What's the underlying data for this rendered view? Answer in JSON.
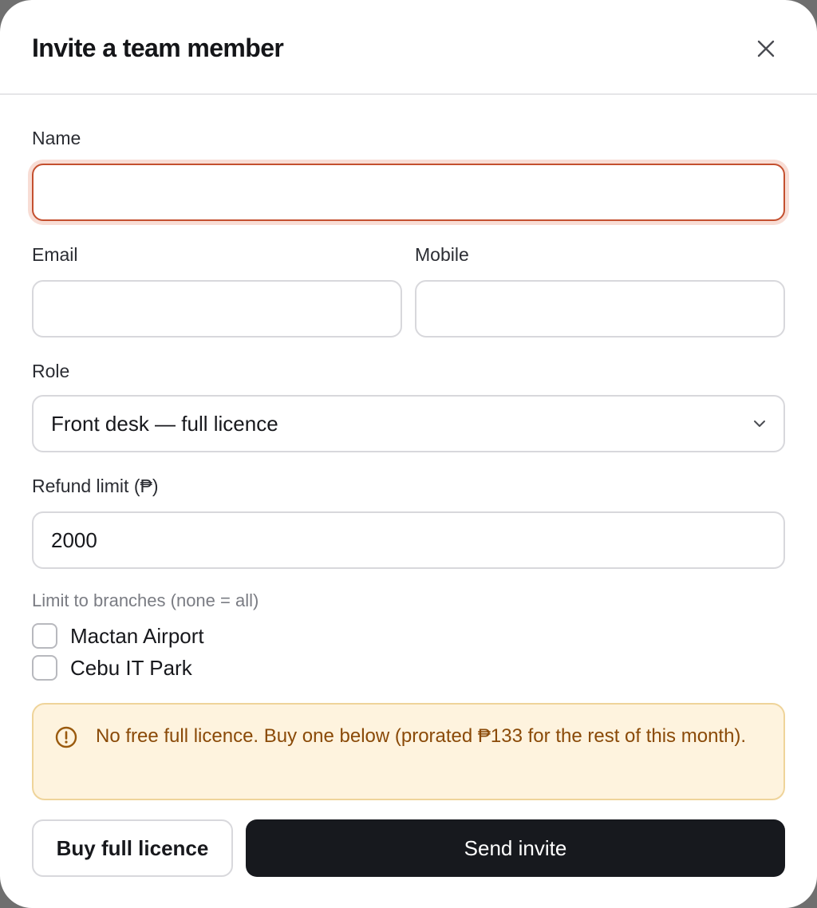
{
  "modal": {
    "title": "Invite a team member",
    "close_icon": "close-icon"
  },
  "form": {
    "name": {
      "label": "Name",
      "value": ""
    },
    "email": {
      "label": "Email",
      "value": ""
    },
    "mobile": {
      "label": "Mobile",
      "value": ""
    },
    "role": {
      "label": "Role",
      "selected": "Front desk — full licence",
      "icon": "chevron-down-icon"
    },
    "refund_limit": {
      "label": "Refund limit (₱)",
      "value": "2000"
    },
    "branches": {
      "hint": "Limit to branches (none = all)",
      "options": [
        {
          "label": "Mactan Airport",
          "checked": false
        },
        {
          "label": "Cebu IT Park",
          "checked": false
        }
      ]
    }
  },
  "warning": {
    "icon": "alert-circle-icon",
    "message": "No free full licence. Buy one below (prorated ₱133 for the rest of this month)."
  },
  "actions": {
    "buy_label": "Buy full licence",
    "send_label": "Send invite"
  },
  "colors": {
    "focus_border": "#c4502f",
    "warning_bg": "#fef3de",
    "warning_text": "#8a4a08",
    "primary_button": "#17191e"
  }
}
